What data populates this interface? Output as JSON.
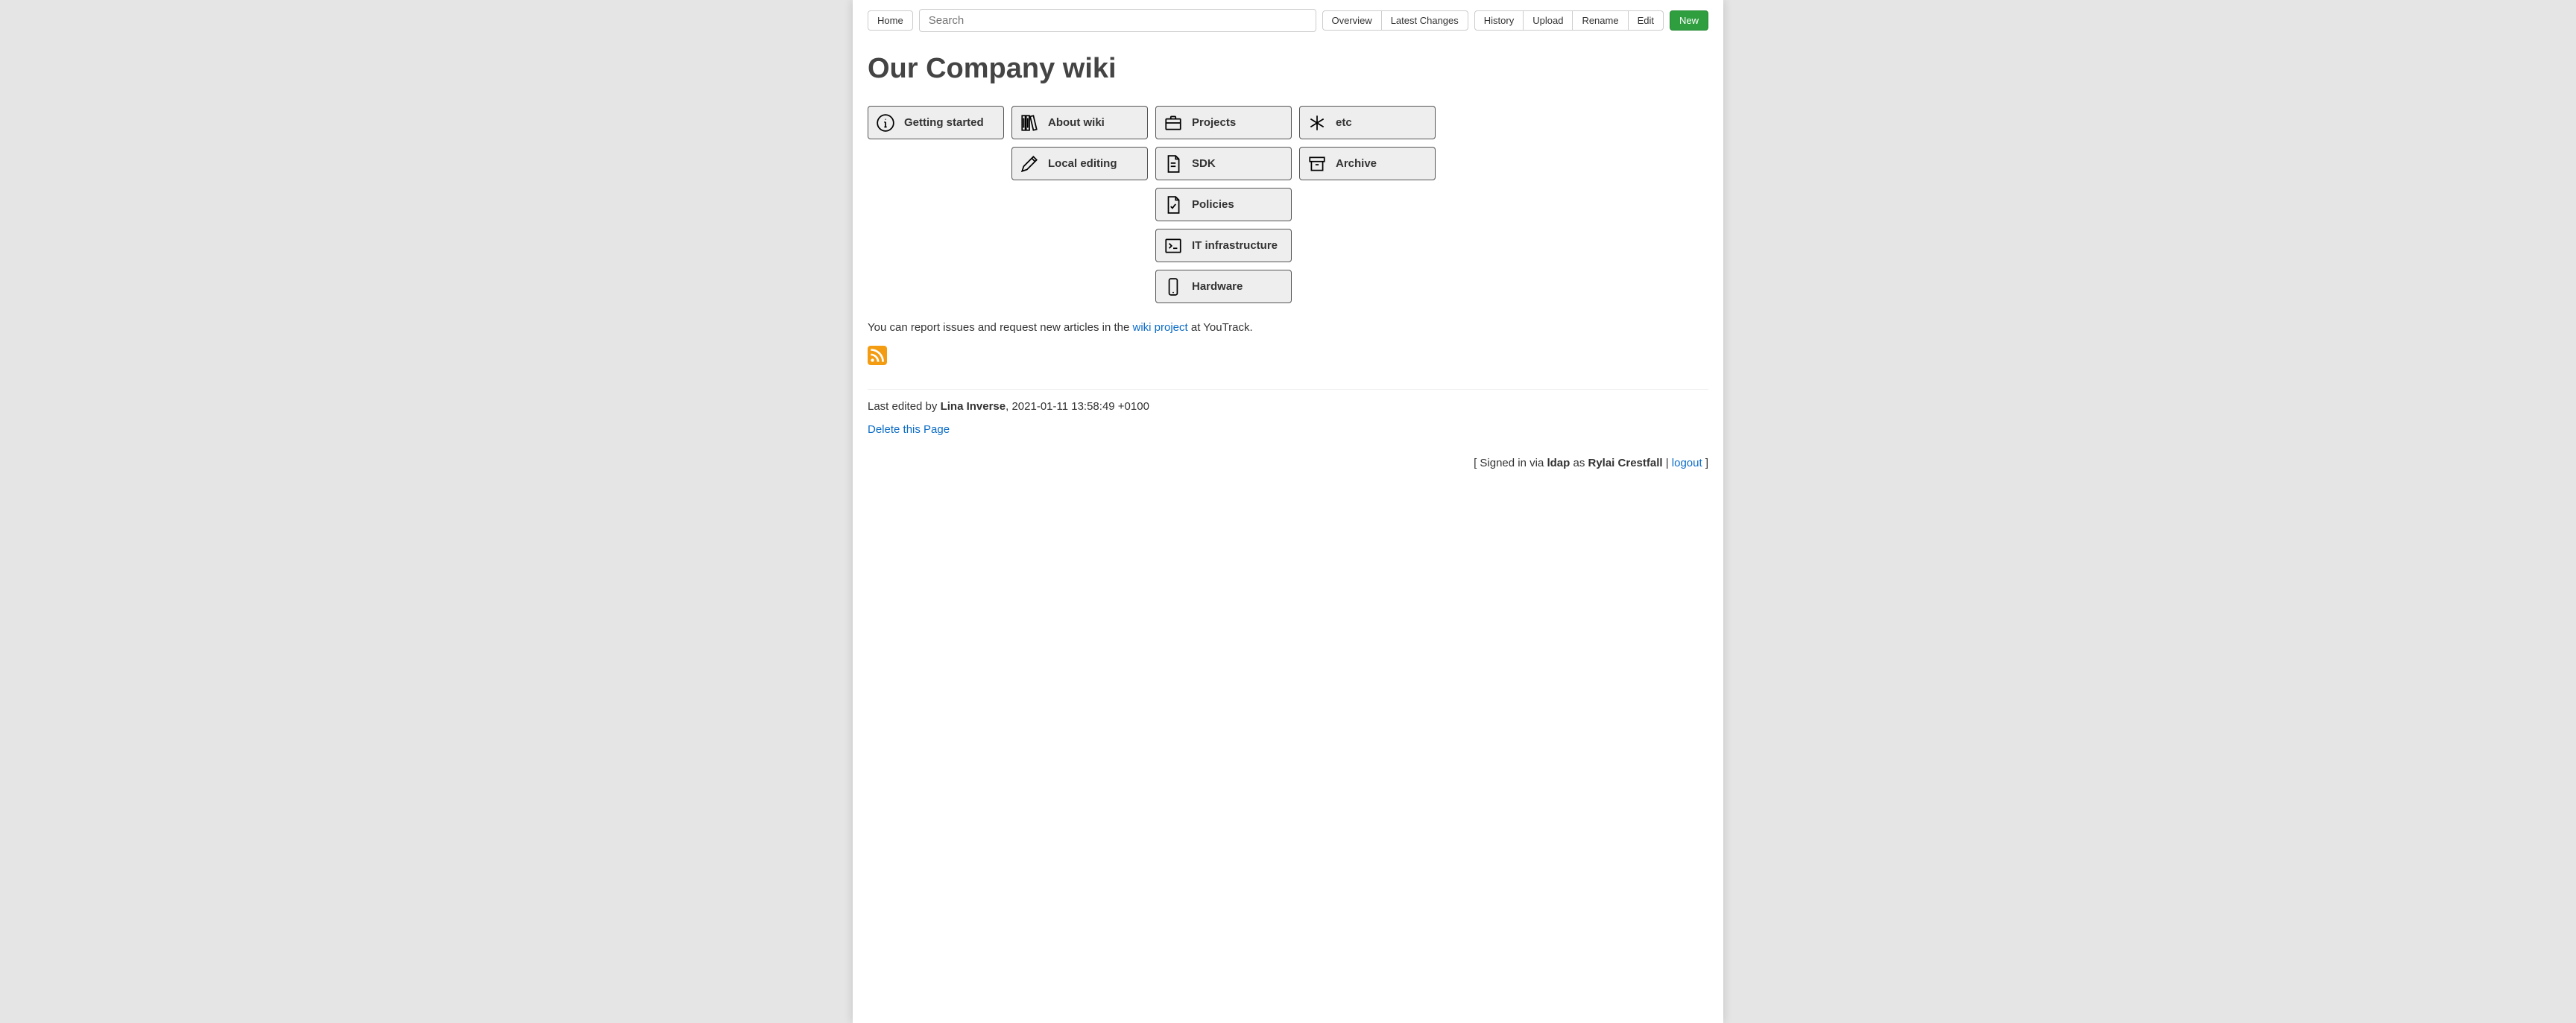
{
  "toolbar": {
    "home": "Home",
    "search_placeholder": "Search",
    "group1": {
      "overview": "Overview",
      "latest_changes": "Latest Changes"
    },
    "group2": {
      "history": "History",
      "upload": "Upload",
      "rename": "Rename",
      "edit": "Edit"
    },
    "new": "New"
  },
  "page_title": "Our Company wiki",
  "tiles": {
    "col1": [
      {
        "label": "Getting started",
        "icon": "info-icon"
      }
    ],
    "col2": [
      {
        "label": "About wiki",
        "icon": "books-icon"
      },
      {
        "label": "Local editing",
        "icon": "pencil-icon"
      }
    ],
    "col3": [
      {
        "label": "Projects",
        "icon": "briefcase-icon"
      },
      {
        "label": "SDK",
        "icon": "document-icon"
      },
      {
        "label": "Policies",
        "icon": "file-check-icon"
      },
      {
        "label": "IT infrastructure",
        "icon": "terminal-icon"
      },
      {
        "label": "Hardware",
        "icon": "mobile-icon"
      }
    ],
    "col4": [
      {
        "label": "etc",
        "icon": "asterisk-icon"
      },
      {
        "label": "Archive",
        "icon": "archive-icon"
      }
    ]
  },
  "report_text": {
    "pre": "You can report issues and request new articles in the ",
    "link": "wiki project",
    "post": " at YouTrack."
  },
  "edited": {
    "pre": "Last edited by ",
    "author": "Lina Inverse",
    "post": ", 2021-01-11 13:58:49 +0100"
  },
  "delete_label": "Delete this Page",
  "footer": {
    "pre": "[ Signed in via ",
    "provider": "ldap",
    "as": " as ",
    "user": "Rylai Crestfall",
    "sep": " | ",
    "logout": "logout",
    "post": " ]"
  }
}
